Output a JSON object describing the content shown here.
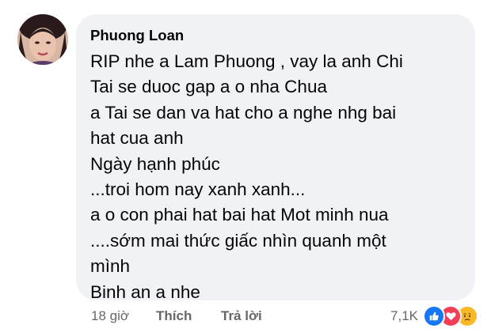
{
  "comment": {
    "avatar_icon": "user-avatar",
    "author": "Phuong Loan",
    "lines": [
      "RIP nhe a Lam Phuong , vay la anh Chi",
      "Tai se duoc gap a o nha Chua",
      "a Tai se dan va hat cho a nghe nhg bai",
      "hat cua anh",
      "Ngày hạnh phúc",
      "...troi hom nay xanh xanh...",
      "a o con phai hat bai hat Mot minh nua",
      "....sớm mai thức giấc nhìn quanh một",
      "mình",
      "Binh an a nhe"
    ]
  },
  "actions": {
    "time": "18 giờ",
    "like_label": "Thích",
    "reply_label": "Trả lời"
  },
  "reactions": {
    "count": "7,1K",
    "icons": [
      "like-reaction-icon",
      "love-reaction-icon",
      "sad-reaction-icon"
    ],
    "colors": {
      "like": "#1877f2",
      "love": "#f33e58",
      "sad": "#f7b928"
    }
  },
  "colors": {
    "bubble": "#f0f2f5",
    "text": "#050505",
    "meta": "#65676b"
  }
}
